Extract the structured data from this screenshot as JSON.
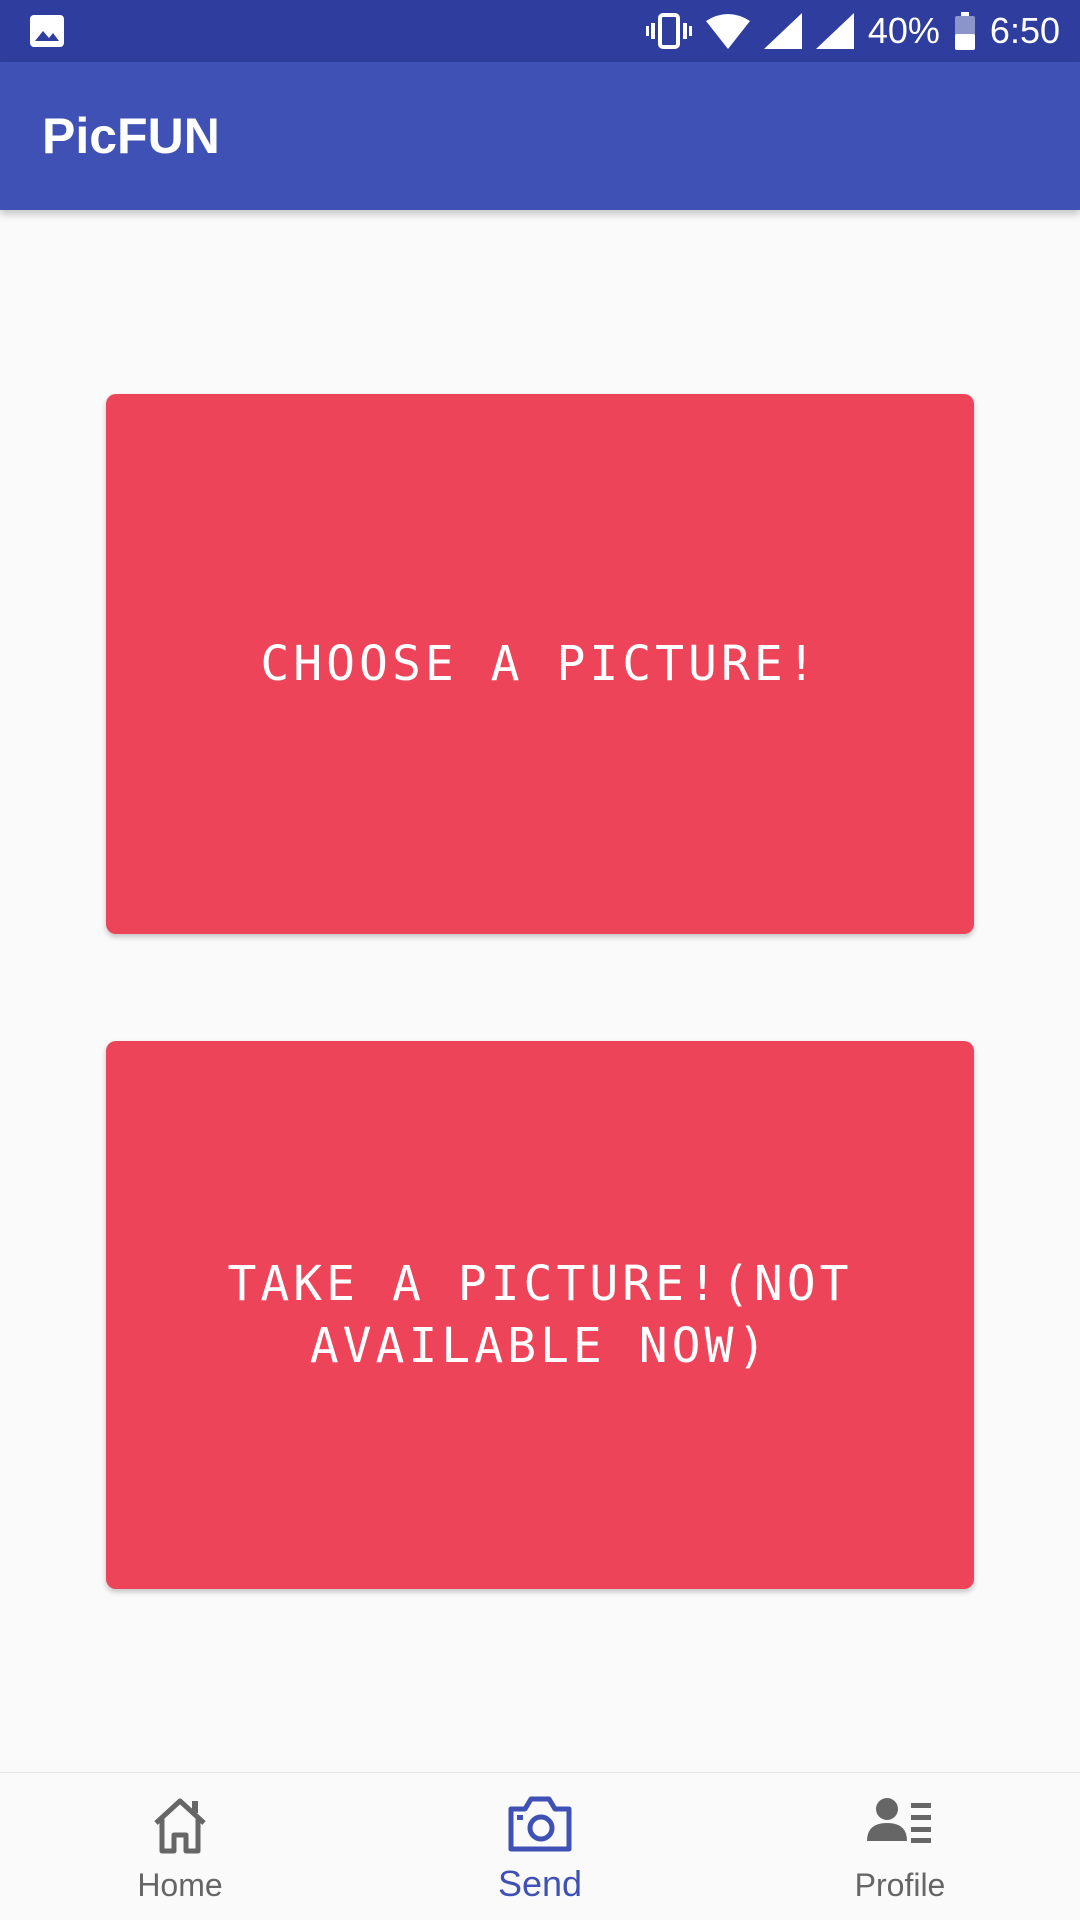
{
  "status_bar": {
    "left_icon": "image-notification-icon",
    "icons": [
      "vibrate-icon",
      "wifi-icon",
      "signal-icon",
      "signal-icon",
      "battery-icon"
    ],
    "battery": "40%",
    "time": "6:50"
  },
  "app_bar": {
    "title": "PicFUN"
  },
  "main": {
    "choose_label": "CHOOSE A PICTURE!",
    "take_label": "TAKE A PICTURE!(NOT AVAILABLE NOW)"
  },
  "bottom_nav": {
    "items": [
      {
        "label": "Home",
        "icon": "home-icon",
        "active": false
      },
      {
        "label": "Send",
        "icon": "camera-icon",
        "active": true
      },
      {
        "label": "Profile",
        "icon": "profile-icon",
        "active": false
      }
    ]
  },
  "colors": {
    "status_bar": "#2f3e9e",
    "app_bar": "#3f51b5",
    "button": "#ee4459",
    "active_nav": "#3f51b5",
    "inactive_nav": "#666666",
    "background": "#fafafa"
  }
}
